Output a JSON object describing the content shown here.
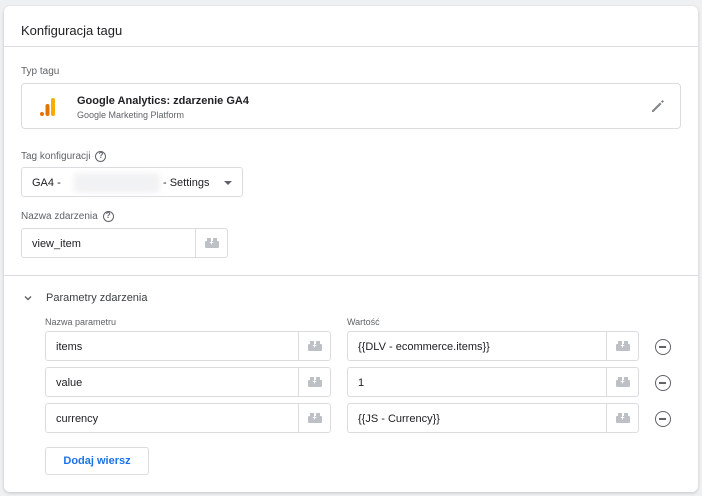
{
  "card": {
    "title": "Konfiguracja tagu"
  },
  "tag_type": {
    "label": "Typ tagu",
    "name": "Google Analytics: zdarzenie GA4",
    "provider": "Google Marketing Platform",
    "logo_icon": "google-analytics-icon",
    "edit_icon": "pencil-icon"
  },
  "config_tag": {
    "label": "Tag konfiguracji",
    "value_prefix": "GA4 -",
    "value_suffix": "- Settings",
    "help_icon": "help-icon"
  },
  "event_name": {
    "label": "Nazwa zdarzenia",
    "value": "view_item",
    "help_icon": "help-icon",
    "variable_icon": "variable-picker-icon"
  },
  "params": {
    "section_label": "Parametry zdarzenia",
    "col_name": "Nazwa parametru",
    "col_value": "Wartość",
    "rows": [
      {
        "name": "items",
        "value": "{{DLV - ecommerce.items}}"
      },
      {
        "name": "value",
        "value": "1"
      },
      {
        "name": "currency",
        "value": "{{JS - Currency}}"
      }
    ],
    "add_row_label": "Dodaj wiersz",
    "remove_icon": "remove-circle-icon"
  },
  "colors": {
    "accent": "#1a73e8",
    "ga_orange": "#f9ab00",
    "ga_dark": "#e37400",
    "border": "#dadce0"
  }
}
